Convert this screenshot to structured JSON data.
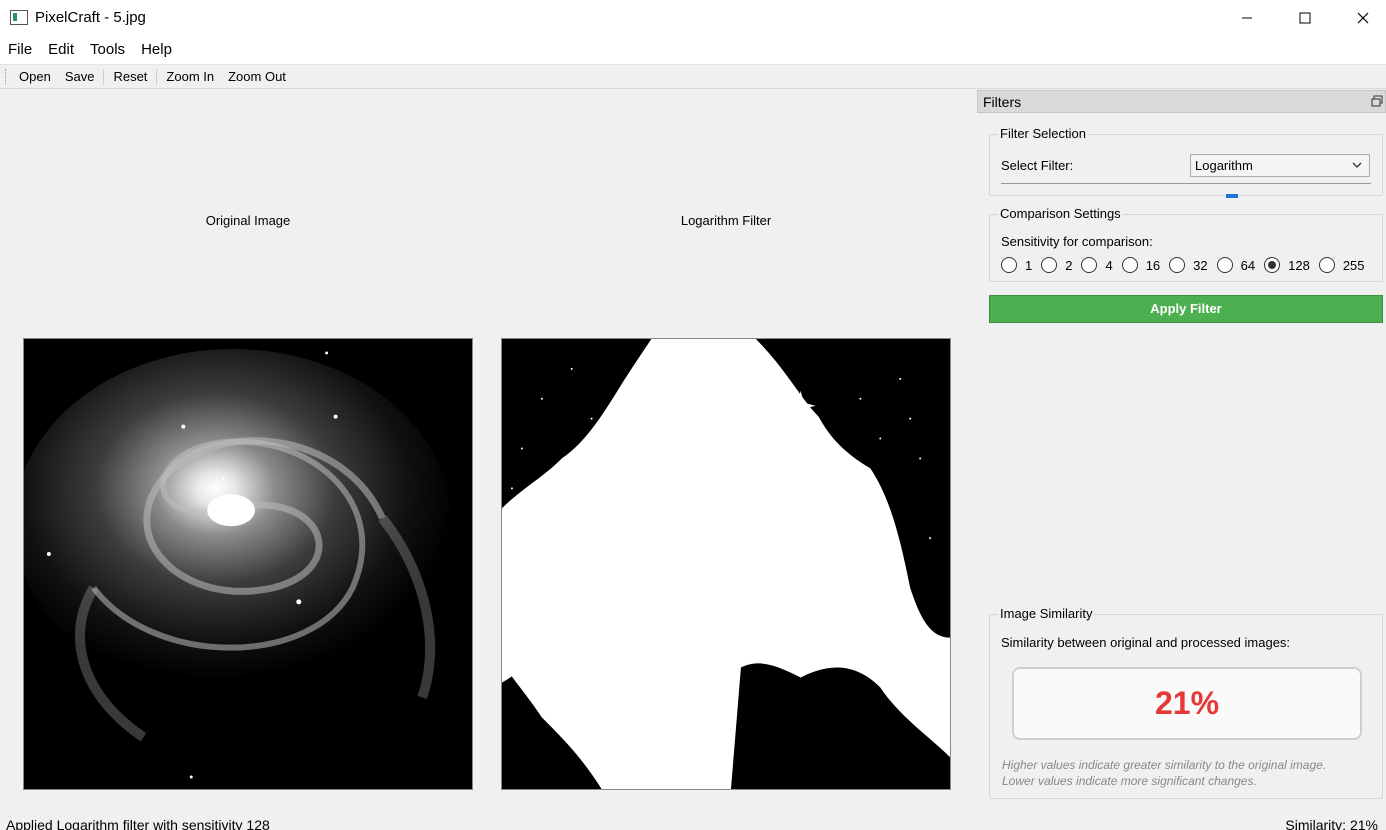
{
  "window": {
    "title": "PixelCraft - 5.jpg",
    "min": "—",
    "max": "☐",
    "close": "✕"
  },
  "menu": [
    "File",
    "Edit",
    "Tools",
    "Help"
  ],
  "toolbar": {
    "open": "Open",
    "save": "Save",
    "reset": "Reset",
    "zoom_in": "Zoom In",
    "zoom_out": "Zoom Out"
  },
  "views": {
    "original_label": "Original Image",
    "processed_label": "Logarithm Filter"
  },
  "dock": {
    "title": "Filters",
    "filter_selection": {
      "title": "Filter Selection",
      "label": "Select Filter:",
      "value": "Logarithm"
    },
    "comparison": {
      "title": "Comparison Settings",
      "label": "Sensitivity for comparison:",
      "options": [
        "1",
        "2",
        "4",
        "16",
        "32",
        "64",
        "128",
        "255"
      ],
      "selected": "128"
    },
    "apply_label": "Apply Filter",
    "similarity": {
      "title": "Image Similarity",
      "label": "Similarity between original and processed images:",
      "value": "21%",
      "note_1": "Higher values indicate greater similarity to the original image.",
      "note_2": "Lower values indicate more significant changes."
    }
  },
  "colors": {
    "apply": "#4caf50",
    "similarity_value": "#e53935",
    "tab_indicator": "#1e78d2"
  },
  "status": {
    "left": "Applied Logarithm filter with sensitivity 128",
    "right": "Similarity: 21%"
  }
}
